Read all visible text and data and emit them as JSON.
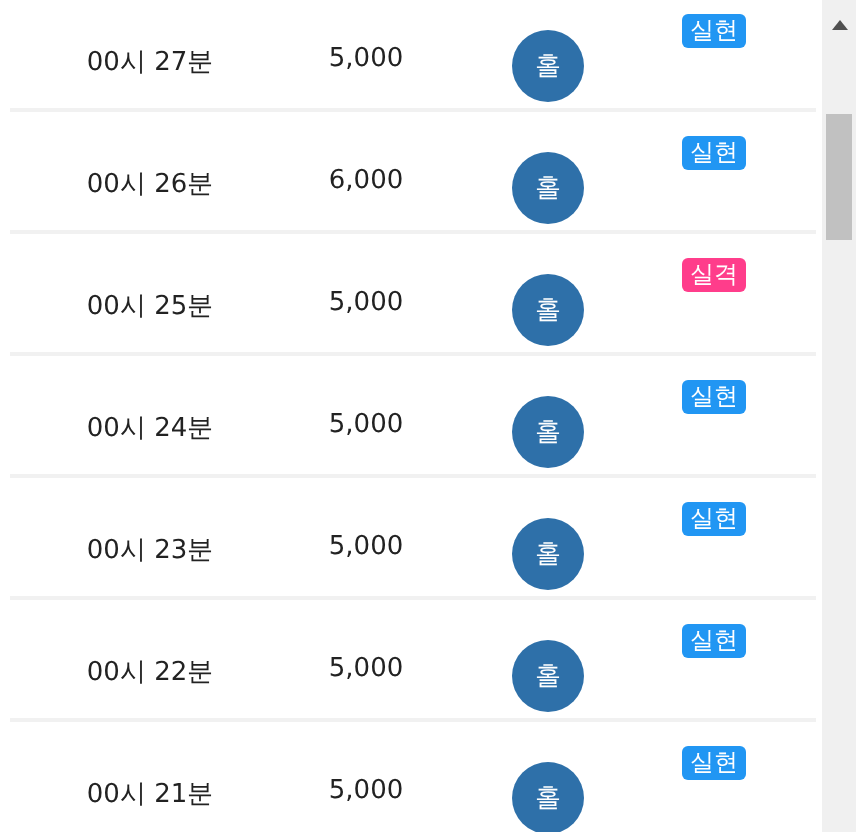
{
  "rows": [
    {
      "time": "00시 27분",
      "amount": "5,000",
      "pick": "홀",
      "result": "실현",
      "color": "#2196f3"
    },
    {
      "time": "00시 26분",
      "amount": "6,000",
      "pick": "홀",
      "result": "실현",
      "color": "#2196f3"
    },
    {
      "time": "00시 25분",
      "amount": "5,000",
      "pick": "홀",
      "result": "실격",
      "color": "#ff3d8b"
    },
    {
      "time": "00시 24분",
      "amount": "5,000",
      "pick": "홀",
      "result": "실현",
      "color": "#2196f3"
    },
    {
      "time": "00시 23분",
      "amount": "5,000",
      "pick": "홀",
      "result": "실현",
      "color": "#2196f3"
    },
    {
      "time": "00시 22분",
      "amount": "5,000",
      "pick": "홀",
      "result": "실현",
      "color": "#2196f3"
    },
    {
      "time": "00시 21분",
      "amount": "5,000",
      "pick": "홀",
      "result": "실현",
      "color": "#2196f3"
    }
  ]
}
